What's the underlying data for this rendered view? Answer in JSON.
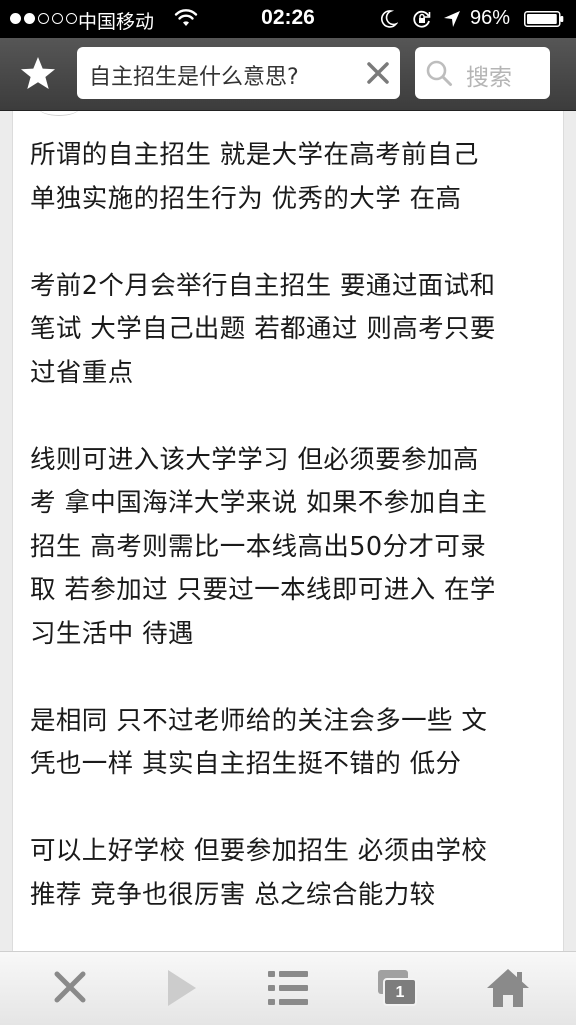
{
  "status_bar": {
    "carrier": "中国移动",
    "time": "02:26",
    "battery_percent": "96%",
    "battery_level": 0.96,
    "signal_bars_filled": 2,
    "signal_bars_total": 5
  },
  "toolbar": {
    "search_query": "自主招生是什么意思?",
    "search_button_label": "搜索"
  },
  "answer": {
    "paragraphs": [
      [
        "所谓的自主招生 就是大学在高考前自己",
        "单独实施的招生行为 优秀的大学 在高"
      ],
      [
        "考前2个月会举行自主招生 要通过面试和",
        "笔试 大学自己出题 若都通过 则高考只要",
        "过省重点"
      ],
      [
        "线则可进入该大学学习 但必须要参加高",
        "考 拿中国海洋大学来说 如果不参加自主",
        "招生 高考则需比一本线高出50分才可录",
        "取 若参加过 只要过一本线即可进入 在学",
        "习生活中 待遇"
      ],
      [
        "是相同 只不过老师给的关注会多一些 文",
        "凭也一样 其实自主招生挺不错的 低分"
      ],
      [
        "可以上好学校 但要参加招生 必须由学校",
        "推荐 竞争也很厉害 总之综合能力较"
      ]
    ]
  },
  "bottom_bar": {
    "tab_count": "1"
  },
  "icons": {
    "star": "star-icon",
    "clear": "close-icon",
    "search": "search-icon",
    "close_page": "close-icon",
    "forward": "play-forward-icon",
    "menu": "list-menu-icon",
    "tabs": "tabs-icon",
    "home": "home-icon"
  },
  "colors": {
    "toolbar": "#484848",
    "text": "#1a1a1a",
    "placeholder": "#b5b5b5",
    "icon_gray": "#8a8a8a",
    "icon_light": "#cccccc"
  }
}
